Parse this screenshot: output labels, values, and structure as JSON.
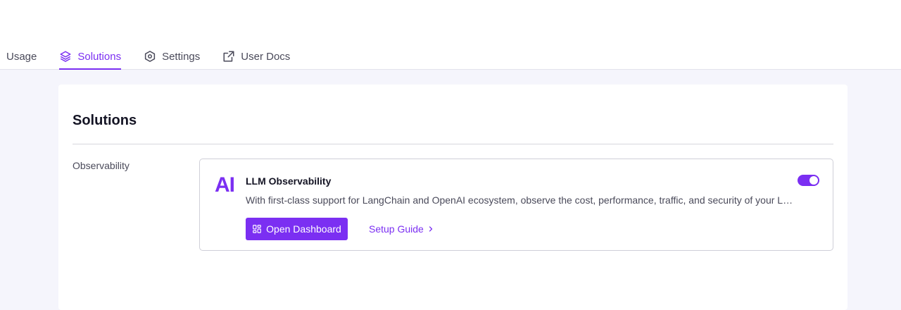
{
  "nav": {
    "tabs": [
      {
        "label": "Usage",
        "icon": "none"
      },
      {
        "label": "Solutions",
        "icon": "layers-icon",
        "active": true
      },
      {
        "label": "Settings",
        "icon": "hexagon-gear-icon"
      },
      {
        "label": "User Docs",
        "icon": "external-link-icon"
      }
    ]
  },
  "panel": {
    "title": "Solutions",
    "section_label": "Observability"
  },
  "card": {
    "logo_text": "AI",
    "title": "LLM Observability",
    "description": "With first-class support for LangChain and OpenAI ecosystem, observe the cost, performance, traffic, and security of your LLM-based applications.",
    "toggle_on": true,
    "open_dashboard_label": "Open Dashboard",
    "setup_guide_label": "Setup Guide"
  },
  "colors": {
    "accent": "#7b2ff2",
    "background": "#f5f5fc"
  }
}
